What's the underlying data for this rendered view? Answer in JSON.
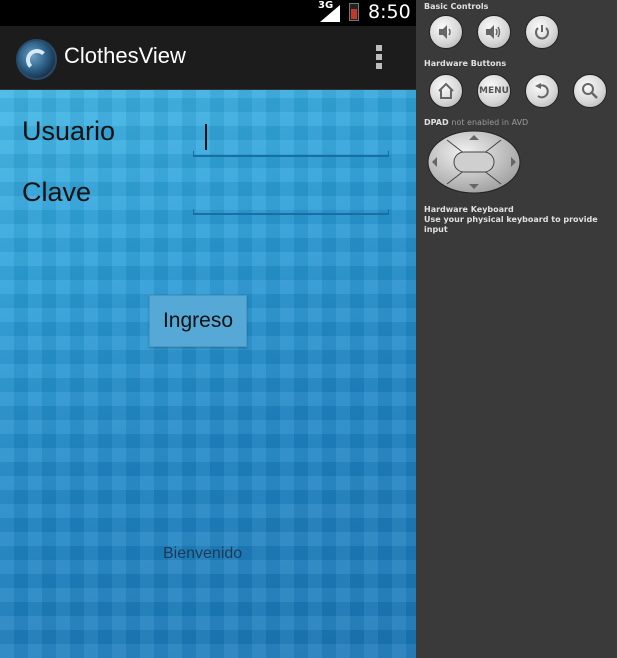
{
  "status_bar": {
    "network": "3G",
    "time": "8:50"
  },
  "action_bar": {
    "title": "ClothesView"
  },
  "form": {
    "user_label": "Usuario",
    "user_value": "",
    "password_label": "Clave",
    "password_value": "",
    "submit_label": "Ingreso",
    "welcome_text": "Bienvenido"
  },
  "emulator": {
    "basic_controls_title": "Basic Controls",
    "hardware_buttons_title": "Hardware Buttons",
    "menu_label": "MENU",
    "dpad_title": "DPAD",
    "dpad_note": "not enabled in AVD",
    "keyboard_title": "Hardware Keyboard",
    "keyboard_note": "Use your physical keyboard to provide input"
  }
}
